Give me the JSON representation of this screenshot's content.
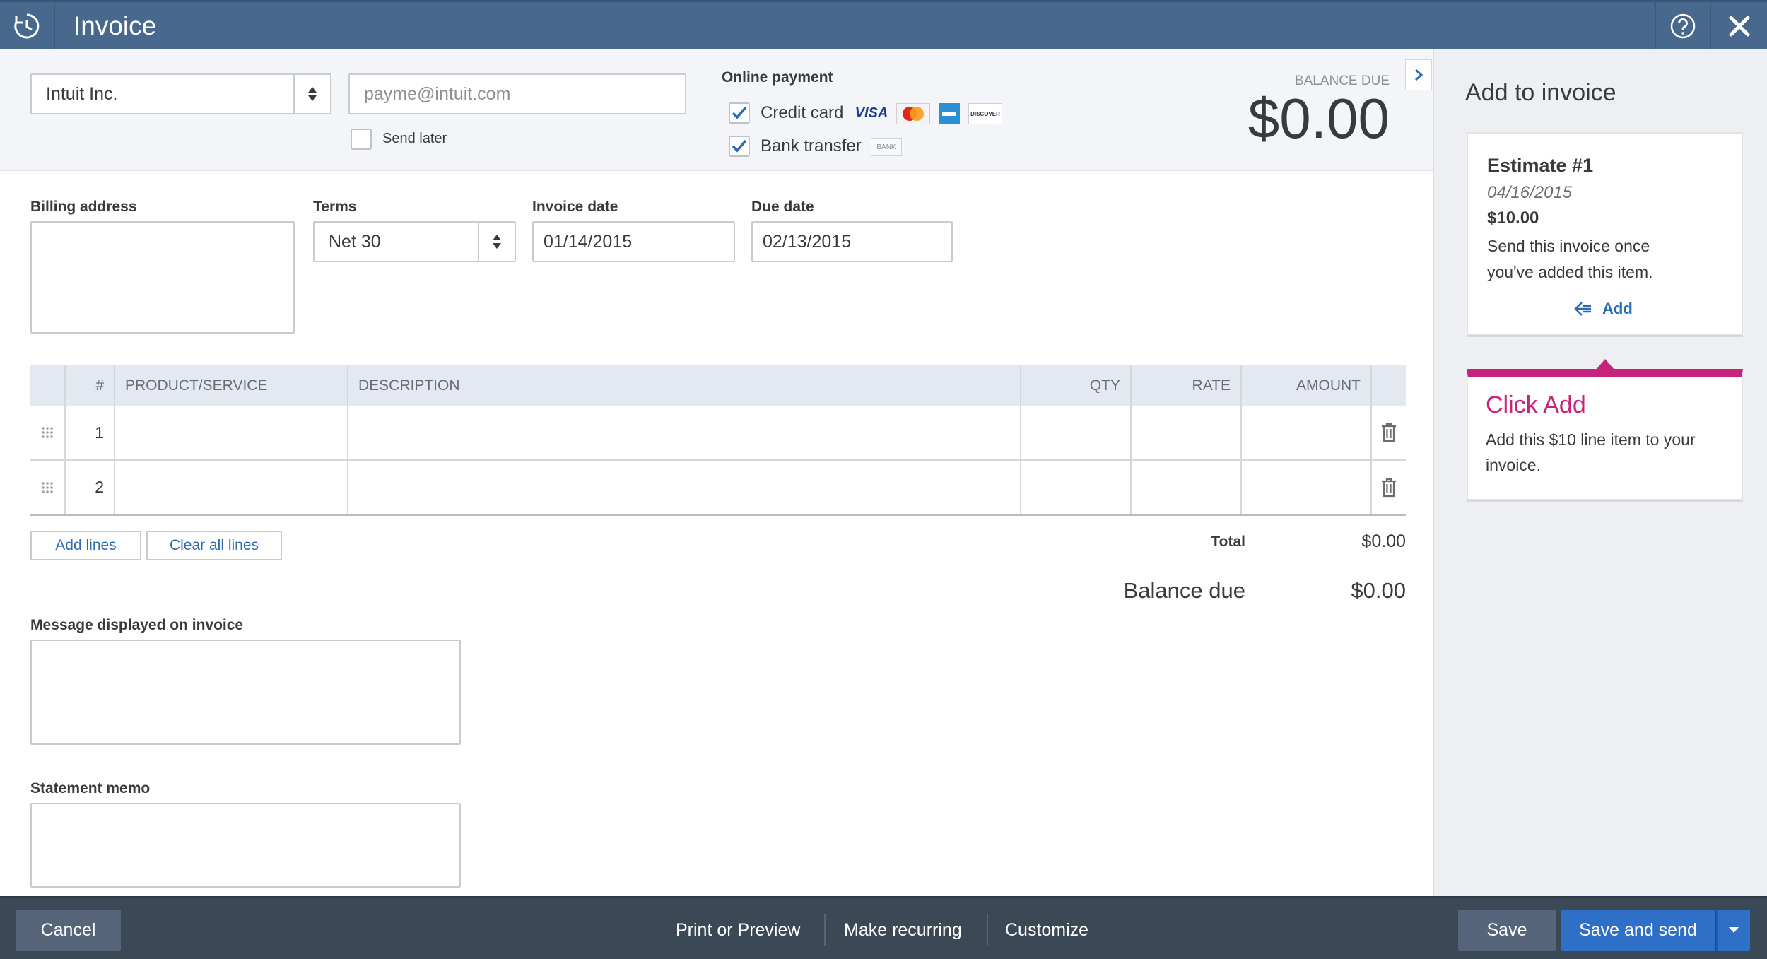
{
  "header": {
    "title": "Invoice"
  },
  "customer": {
    "name": "Intuit Inc.",
    "email_placeholder": "payme@intuit.com"
  },
  "send_later": {
    "label": "Send later",
    "checked": false
  },
  "online_payment": {
    "heading": "Online payment",
    "credit_card": {
      "label": "Credit card",
      "checked": true
    },
    "bank_transfer": {
      "label": "Bank transfer",
      "checked": true,
      "badge": "BANK"
    },
    "card_logos": {
      "visa": "VISA",
      "mastercard": "MasterCard",
      "amex": "AMEX",
      "discover": "DISCOVER"
    }
  },
  "balance_due": {
    "label": "BALANCE DUE",
    "amount": "$0.00"
  },
  "billing_address": {
    "label": "Billing address"
  },
  "terms": {
    "label": "Terms",
    "value": "Net 30"
  },
  "invoice_date": {
    "label": "Invoice date",
    "value": "01/14/2015"
  },
  "due_date": {
    "label": "Due date",
    "value": "02/13/2015"
  },
  "table": {
    "columns": {
      "num": "#",
      "product": "PRODUCT/SERVICE",
      "description": "DESCRIPTION",
      "qty": "QTY",
      "rate": "RATE",
      "amount": "AMOUNT"
    },
    "rows": [
      {
        "num": "1"
      },
      {
        "num": "2"
      }
    ]
  },
  "actions": {
    "add_lines": "Add lines",
    "clear_lines": "Clear all lines"
  },
  "totals": {
    "total_label": "Total",
    "total_value": "$0.00",
    "balance_label": "Balance due",
    "balance_value": "$0.00"
  },
  "message": {
    "label": "Message displayed on invoice"
  },
  "memo": {
    "label": "Statement memo"
  },
  "panel": {
    "title": "Add to invoice",
    "estimate": {
      "title": "Estimate #1",
      "date": "04/16/2015",
      "amount": "$10.00",
      "note": "Send this invoice once you've added this item.",
      "add_label": "Add"
    },
    "tip": {
      "title": "Click Add",
      "body": "Add this $10 line item to your invoice."
    }
  },
  "footer": {
    "cancel": "Cancel",
    "print": "Print or Preview",
    "recurring": "Make recurring",
    "customize": "Customize",
    "save": "Save",
    "save_send": "Save and send"
  },
  "colors": {
    "header": "#48698d",
    "footer": "#3b4855",
    "link": "#2d6bb4",
    "save_send": "#2e6fc7",
    "tip_accent": "#c8237a",
    "check": "#2d6bb4"
  }
}
